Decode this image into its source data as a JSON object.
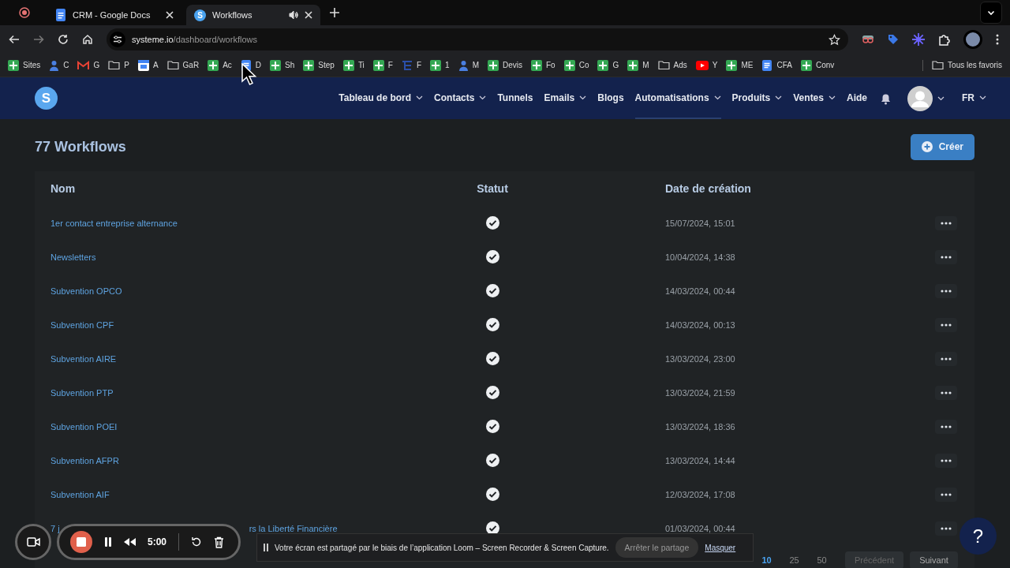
{
  "browser": {
    "tabs": [
      {
        "title": "CRM - Google Docs",
        "kind": "docs",
        "selected": false
      },
      {
        "title": "Workflows",
        "kind": "systeme",
        "favicon_letter": "S",
        "selected": true
      }
    ],
    "url": {
      "host": "systeme.io",
      "path": "/dashboard/workflows"
    },
    "bookmarks": [
      {
        "label": "Sites",
        "kind": "sheet"
      },
      {
        "label": "C",
        "kind": "person"
      },
      {
        "label": "G",
        "kind": "mail"
      },
      {
        "label": "P",
        "kind": "folder"
      },
      {
        "label": "A",
        "kind": "calendar"
      },
      {
        "label": "GaR",
        "kind": "folder"
      },
      {
        "label": "Ac",
        "kind": "sheet"
      },
      {
        "label": "D",
        "kind": "doc"
      },
      {
        "label": "Sh",
        "kind": "sheet"
      },
      {
        "label": "Step",
        "kind": "sheet"
      },
      {
        "label": "Ti",
        "kind": "sheet"
      },
      {
        "label": "F",
        "kind": "sheet"
      },
      {
        "label": "F",
        "kind": "tree"
      },
      {
        "label": "1",
        "kind": "sheet"
      },
      {
        "label": "M",
        "kind": "person"
      },
      {
        "label": "Devis",
        "kind": "sheet"
      },
      {
        "label": "Fo",
        "kind": "sheet"
      },
      {
        "label": "Co",
        "kind": "sheet"
      },
      {
        "label": "G",
        "kind": "sheet"
      },
      {
        "label": "M",
        "kind": "sheet"
      },
      {
        "label": "Ads",
        "kind": "folder"
      },
      {
        "label": "Y",
        "kind": "video"
      },
      {
        "label": "ME",
        "kind": "sheet"
      },
      {
        "label": "CFA",
        "kind": "doc"
      },
      {
        "label": "Conv",
        "kind": "sheet"
      }
    ],
    "all_bookmarks": "Tous les favoris"
  },
  "nav": {
    "items": [
      {
        "label": "Tableau de bord",
        "dropdown": true,
        "selected": false
      },
      {
        "label": "Contacts",
        "dropdown": true,
        "selected": false
      },
      {
        "label": "Tunnels",
        "dropdown": false,
        "selected": false
      },
      {
        "label": "Emails",
        "dropdown": true,
        "selected": false
      },
      {
        "label": "Blogs",
        "dropdown": false,
        "selected": false
      },
      {
        "label": "Automatisations",
        "dropdown": true,
        "selected": true
      },
      {
        "label": "Produits",
        "dropdown": true,
        "selected": false
      },
      {
        "label": "Ventes",
        "dropdown": true,
        "selected": false
      },
      {
        "label": "Aide",
        "dropdown": false,
        "selected": false
      }
    ],
    "language": "FR",
    "logo_letter": "S"
  },
  "page": {
    "title": "77 Workflows",
    "create_button": "Créer",
    "columns": [
      "Nom",
      "Statut",
      "Date de création"
    ],
    "rows": [
      {
        "name": "1er contact entreprise alternance",
        "active": true,
        "date": "15/07/2024, 15:01"
      },
      {
        "name": "Newsletters",
        "active": true,
        "date": "10/04/2024, 14:38"
      },
      {
        "name": "Subvention OPCO",
        "active": true,
        "date": "14/03/2024, 00:44"
      },
      {
        "name": "Subvention CPF",
        "active": true,
        "date": "14/03/2024, 00:13"
      },
      {
        "name": "Subvention AIRE",
        "active": true,
        "date": "13/03/2024, 23:00"
      },
      {
        "name": "Subvention PTP",
        "active": true,
        "date": "13/03/2024, 21:59"
      },
      {
        "name": "Subvention POEI",
        "active": true,
        "date": "13/03/2024, 18:36"
      },
      {
        "name": "Subvention AFPR",
        "active": true,
        "date": "13/03/2024, 14:44"
      },
      {
        "name": "Subvention AIF",
        "active": true,
        "date": "12/03/2024, 17:08"
      },
      {
        "name": "7 j",
        "name_tail": "rs la Liberté Financière",
        "active": true,
        "date": "01/03/2024, 00:44"
      }
    ],
    "page_sizes": [
      {
        "label": "10",
        "selected": true
      },
      {
        "label": "25",
        "selected": false
      },
      {
        "label": "50",
        "selected": false
      }
    ],
    "previous": {
      "label": "Précédent",
      "disabled": true
    },
    "next": {
      "label": "Suivant",
      "disabled": false
    }
  },
  "recorder": {
    "time": "5:00"
  },
  "share_banner": {
    "message": "Votre écran est partagé par le biais de l’application Loom – Screen Recorder & Screen Capture.",
    "stop": "Arrêter le partage",
    "hide": "Masquer"
  },
  "help": "?"
}
